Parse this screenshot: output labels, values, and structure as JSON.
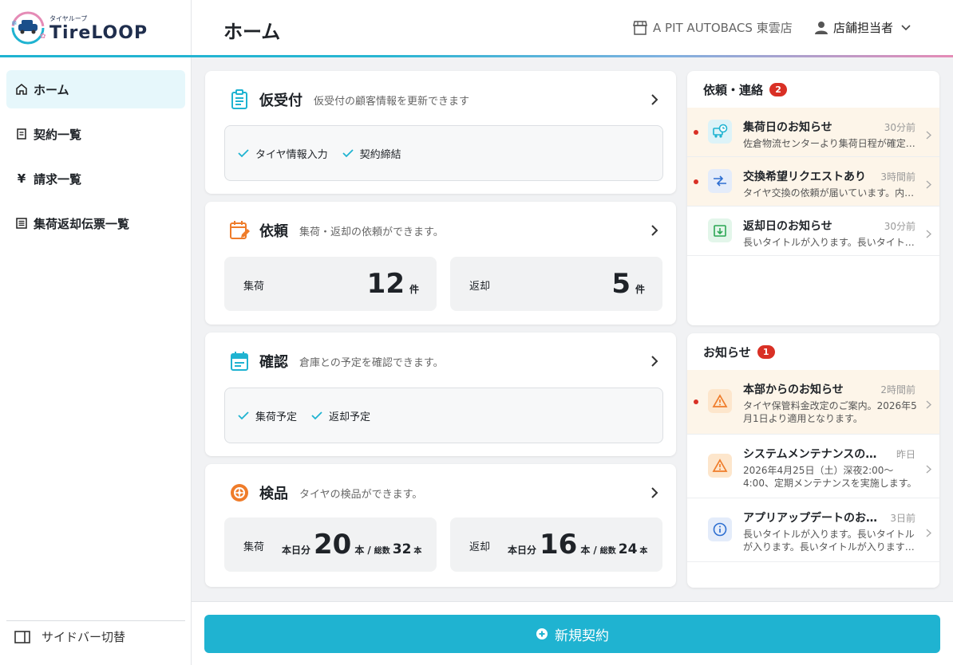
{
  "app": {
    "logo_kana": "タイヤループ",
    "logo_text": "TireLOOP"
  },
  "header": {
    "title": "ホーム",
    "store": "A PIT AUTOBACS 東雲店",
    "user": "店舗担当者"
  },
  "sidebar": {
    "items": [
      {
        "label": "ホーム",
        "icon": "home-icon",
        "active": true
      },
      {
        "label": "契約一覧",
        "icon": "document-icon"
      },
      {
        "label": "請求一覧",
        "icon": "yen-icon"
      },
      {
        "label": "集荷返却伝票一覧",
        "icon": "list-icon"
      }
    ],
    "toggle_label": "サイドバー切替"
  },
  "cards": {
    "provisional": {
      "title": "仮受付",
      "subtitle": "仮受付の顧客情報を更新できます",
      "checks": [
        "タイヤ情報入力",
        "契約締結"
      ]
    },
    "request": {
      "title": "依頼",
      "subtitle": "集荷・返却の依頼ができます。",
      "pickup_label": "集荷",
      "pickup_count": "12",
      "return_label": "返却",
      "return_count": "5",
      "unit": "件"
    },
    "confirm": {
      "title": "確認",
      "subtitle": "倉庫との予定を確認できます。",
      "checks": [
        "集荷予定",
        "返却予定"
      ]
    },
    "inspection": {
      "title": "検品",
      "subtitle": "タイヤの検品ができます。",
      "pickup_label": "集荷",
      "return_label": "返却",
      "today_label": "本日分",
      "unit": "本",
      "slash": "/",
      "total_label": "総数",
      "pickup_today": "20",
      "pickup_total": "32",
      "return_today": "16",
      "return_total": "24"
    }
  },
  "requests_panel": {
    "title": "依頼・連絡",
    "badge": "2",
    "items": [
      {
        "title": "集荷日のお知らせ",
        "time": "30分前",
        "body": "佐倉物流センターより集荷日程が確定…",
        "unread": true,
        "icon": "truck-clock-icon"
      },
      {
        "title": "交換希望リクエストあり",
        "time": "3時間前",
        "body": "タイヤ交換の依頼が届いています。内…",
        "unread": true,
        "icon": "exchange-arrows-icon"
      },
      {
        "title": "返却日のお知らせ",
        "time": "30分前",
        "body": "長いタイトルが入ります。長いタイト…",
        "unread": false,
        "icon": "return-box-icon"
      }
    ]
  },
  "news_panel": {
    "title": "お知らせ",
    "badge": "1",
    "items": [
      {
        "title": "本部からのお知らせ",
        "time": "2時間前",
        "body": "タイヤ保管料金改定のご案内。2026年5月1日より適用となります。",
        "unread": true,
        "icon": "warning-icon"
      },
      {
        "title": "システムメンテナンスのお…",
        "time": "昨日",
        "body": "2026年4月25日（土）深夜2:00〜4:00、定期メンテナンスを実施します。",
        "unread": false,
        "icon": "warning-icon"
      },
      {
        "title": "アプリアップデートのお知…",
        "time": "3日前",
        "body": "長いタイトルが入ります。長いタイトルが入ります。長いタイトルが入ります…",
        "unread": false,
        "icon": "info-icon"
      }
    ]
  },
  "actions": {
    "new_contract": "新規契約"
  },
  "colors": {
    "accent": "#1fb3d1",
    "orange": "#ef7c2a",
    "badge_red": "#d93025",
    "unread_bg": "#fdf5e9"
  }
}
